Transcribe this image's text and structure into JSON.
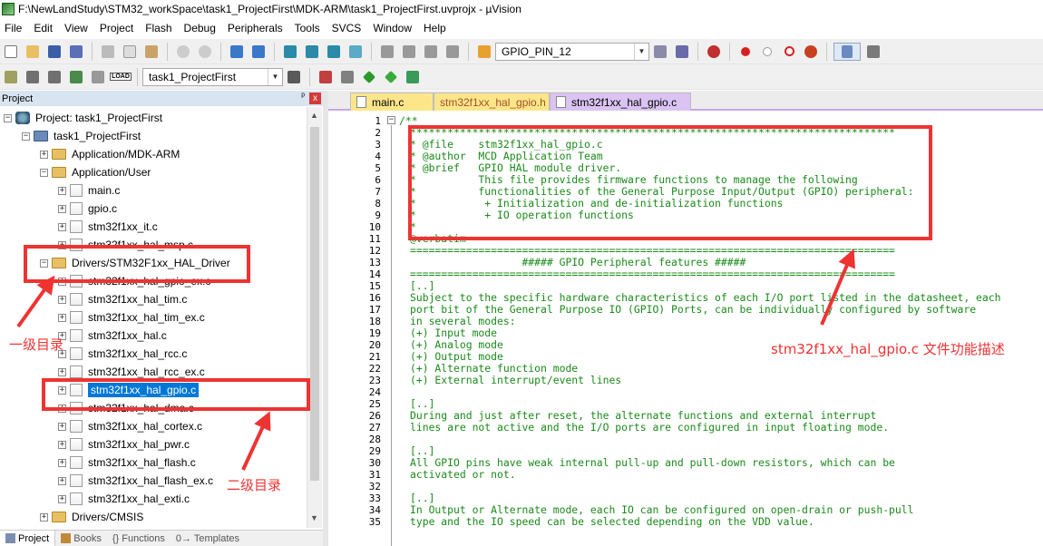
{
  "window": {
    "title": "F:\\NewLandStudy\\STM32_workSpace\\task1_ProjectFirst\\MDK-ARM\\task1_ProjectFirst.uvprojx - µVision"
  },
  "menu": [
    "File",
    "Edit",
    "View",
    "Project",
    "Flash",
    "Debug",
    "Peripherals",
    "Tools",
    "SVCS",
    "Window",
    "Help"
  ],
  "toolbar": {
    "find_combo": "GPIO_PIN_12",
    "target_combo": "task1_ProjectFirst",
    "load_label": "LOAD"
  },
  "project_panel": {
    "title": "Project",
    "pin": "ᵖ",
    "close": "x",
    "tree": [
      {
        "label": "Project: task1_ProjectFirst",
        "expander": "−"
      },
      {
        "label": "task1_ProjectFirst",
        "expander": "−"
      },
      {
        "label": "Application/MDK-ARM",
        "expander": "+"
      },
      {
        "label": "Application/User",
        "expander": "−"
      },
      {
        "label": "main.c",
        "expander": "+"
      },
      {
        "label": "gpio.c",
        "expander": "+"
      },
      {
        "label": "stm32f1xx_it.c",
        "expander": "+"
      },
      {
        "label": "stm32f1xx_hal_msp.c",
        "expander": "+"
      },
      {
        "label": "Drivers/STM32F1xx_HAL_Driver",
        "expander": "−"
      },
      {
        "label": "stm32f1xx_hal_gpio_ex.c",
        "expander": "+"
      },
      {
        "label": "stm32f1xx_hal_tim.c",
        "expander": "+"
      },
      {
        "label": "stm32f1xx_hal_tim_ex.c",
        "expander": "+"
      },
      {
        "label": "stm32f1xx_hal.c",
        "expander": "+"
      },
      {
        "label": "stm32f1xx_hal_rcc.c",
        "expander": "+"
      },
      {
        "label": "stm32f1xx_hal_rcc_ex.c",
        "expander": "+"
      },
      {
        "label": "stm32f1xx_hal_gpio.c",
        "expander": "+"
      },
      {
        "label": "stm32f1xx_hal_dma.c",
        "expander": "+"
      },
      {
        "label": "stm32f1xx_hal_cortex.c",
        "expander": "+"
      },
      {
        "label": "stm32f1xx_hal_pwr.c",
        "expander": "+"
      },
      {
        "label": "stm32f1xx_hal_flash.c",
        "expander": "+"
      },
      {
        "label": "stm32f1xx_hal_flash_ex.c",
        "expander": "+"
      },
      {
        "label": "stm32f1xx_hal_exti.c",
        "expander": "+"
      },
      {
        "label": "Drivers/CMSIS",
        "expander": "+"
      }
    ],
    "bottom_tabs": [
      "Project",
      "Books",
      "{} Functions",
      "0→ Templates"
    ]
  },
  "editor": {
    "tabs": [
      "main.c",
      "stm32f1xx_hal_gpio.h",
      "stm32f1xx_hal_gpio.c"
    ],
    "active_tab": "stm32f1xx_hal_gpio.c",
    "fold_marker": "−",
    "line_numbers": [
      "1",
      "2",
      "3",
      "4",
      "5",
      "6",
      "7",
      "8",
      "9",
      "10",
      "11",
      "12",
      "13",
      "14",
      "15",
      "16",
      "17",
      "18",
      "19",
      "20",
      "21",
      "22",
      "23",
      "24",
      "25",
      "26",
      "27",
      "28",
      "29",
      "30",
      "31",
      "32",
      "33",
      "34",
      "35"
    ],
    "lines": [
      "/**",
      "******************************************************************************",
      "* @file    stm32f1xx_hal_gpio.c",
      "* @author  MCD Application Team",
      "* @brief   GPIO HAL module driver.",
      "*          This file provides firmware functions to manage the following",
      "*          functionalities of the General Purpose Input/Output (GPIO) peripheral:",
      "*           + Initialization and de-initialization functions",
      "*           + IO operation functions",
      "*",
      "@verbatim",
      "==============================================================================",
      "                  ##### GPIO Peripheral features #####",
      "==============================================================================",
      "[..]",
      "Subject to the specific hardware characteristics of each I/O port listed in the datasheet, each",
      "port bit of the General Purpose IO (GPIO) Ports, can be individually configured by software",
      "in several modes:",
      "(+) Input mode",
      "(+) Analog mode",
      "(+) Output mode",
      "(+) Alternate function mode",
      "(+) External interrupt/event lines",
      "",
      "[..]",
      "During and just after reset, the alternate functions and external interrupt",
      "lines are not active and the I/O ports are configured in input floating mode.",
      "",
      "[..]",
      "All GPIO pins have weak internal pull-up and pull-down resistors, which can be",
      "activated or not.",
      "",
      "[..]",
      "In Output or Alternate mode, each IO can be configured on open-drain or push-pull",
      "type and the IO speed can be selected depending on the VDD value."
    ]
  },
  "annotations": {
    "level1": "一级目录",
    "level2": "二级目录",
    "file_desc": "stm32f1xx_hal_gpio.c 文件功能描述"
  },
  "colors": {
    "annotation_red": "#ee3333",
    "selection_blue": "#0078d7",
    "comment_green": "#1a8a1a",
    "active_tab": "#dbc3f2"
  }
}
